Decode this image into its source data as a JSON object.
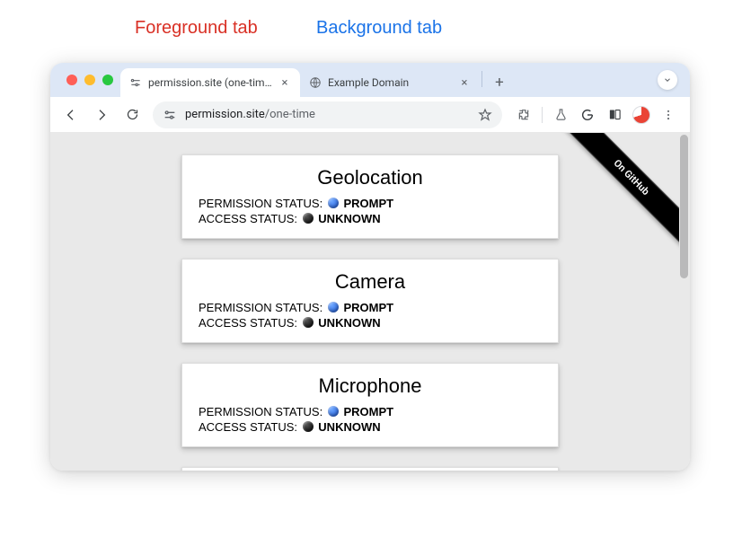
{
  "annotations": {
    "foreground": "Foreground tab",
    "background": "Background tab"
  },
  "window": {
    "tabs": [
      {
        "title": "permission.site (one-time)",
        "active": true,
        "favicon": "permission-tune"
      },
      {
        "title": "Example Domain",
        "active": false,
        "favicon": "globe"
      }
    ],
    "url_host": "permission.site",
    "url_path": "/one-time"
  },
  "ribbon": {
    "label": "On GitHub"
  },
  "permission_cards": [
    {
      "title": "Geolocation",
      "permission_label": "PERMISSION STATUS:",
      "permission_value": "PROMPT",
      "permission_color": "blue",
      "access_label": "ACCESS STATUS:",
      "access_value": "UNKNOWN",
      "access_color": "black"
    },
    {
      "title": "Camera",
      "permission_label": "PERMISSION STATUS:",
      "permission_value": "PROMPT",
      "permission_color": "blue",
      "access_label": "ACCESS STATUS:",
      "access_value": "UNKNOWN",
      "access_color": "black"
    },
    {
      "title": "Microphone",
      "permission_label": "PERMISSION STATUS:",
      "permission_value": "PROMPT",
      "permission_color": "blue",
      "access_label": "ACCESS STATUS:",
      "access_value": "UNKNOWN",
      "access_color": "black"
    }
  ]
}
